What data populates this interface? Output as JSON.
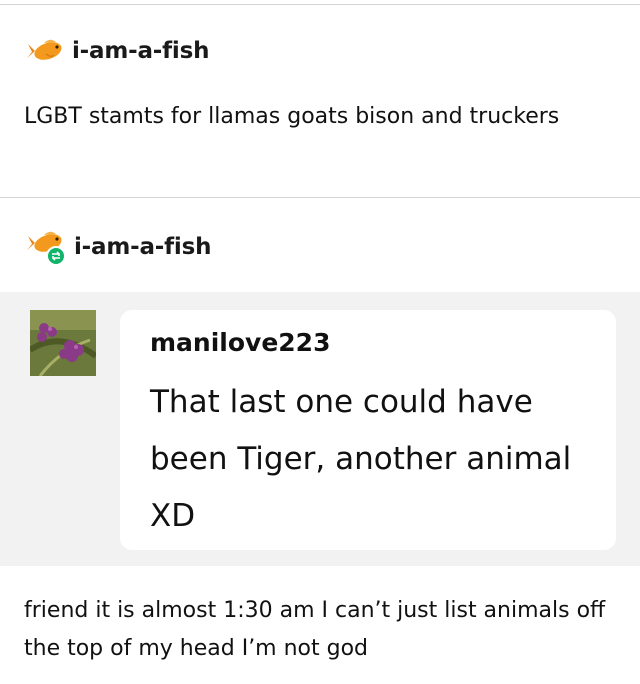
{
  "posts": [
    {
      "username": "i-am-a-fish",
      "avatar_icon": "goldfish-icon",
      "text": "LGBT stamts for llamas goats bison and truckers"
    },
    {
      "username": "i-am-a-fish",
      "avatar_icon": "goldfish-icon",
      "badge_icon": "reblog-icon",
      "ask": {
        "asker": "manilove223",
        "asker_avatar": "berries-avatar",
        "question": "That last one could have been Tiger, another animal XD"
      },
      "answer": "friend it is almost 1:30 am I can’t just list animals off the top of my head I’m not god"
    }
  ],
  "colors": {
    "divider": "#d4d4d4",
    "ask_background": "#f2f2f2",
    "reblog_badge": "#12b36a",
    "fish_orange": "#f39a1e"
  }
}
